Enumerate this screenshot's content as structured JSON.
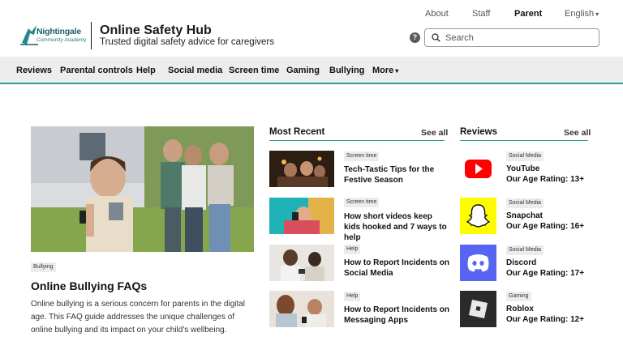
{
  "brand": {
    "logo_name": "Nightingale",
    "logo_sub": "Community Academy",
    "site_title": "Online Safety Hub",
    "site_subtitle": "Trusted digital safety advice for caregivers"
  },
  "top_nav": {
    "about": "About",
    "staff": "Staff",
    "parent": "Parent",
    "language": "English",
    "help_symbol": "?"
  },
  "search": {
    "placeholder": "Search",
    "value": ""
  },
  "main_nav": {
    "items": [
      "Reviews",
      "Parental controls",
      "Help",
      "Social media",
      "Screen time",
      "Gaming",
      "Bullying",
      "More"
    ]
  },
  "featured": {
    "tag": "Bullying",
    "title": "Online Bullying FAQs",
    "description": "Online bullying is a serious concern for parents in the digital age. This FAQ guide addresses the unique challenges of online bullying and its impact on your child's wellbeing."
  },
  "most_recent": {
    "heading": "Most Recent",
    "see_all": "See all",
    "articles": [
      {
        "tag": "Screen time",
        "title": "Tech-Tastic Tips for the Festive Season"
      },
      {
        "tag": "Screen time",
        "title": "How short videos keep kids hooked and 7 ways to help"
      },
      {
        "tag": "Help",
        "title": "How to Report Incidents on Social Media"
      },
      {
        "tag": "Help",
        "title": "How to Report Incidents on Messaging Apps"
      }
    ]
  },
  "reviews": {
    "heading": "Reviews",
    "see_all": "See all",
    "items": [
      {
        "tag": "Social Media",
        "name": "YouTube",
        "rating": "Our Age Rating: 13+",
        "icon": "youtube-icon",
        "color": "#ffffff"
      },
      {
        "tag": "Social Media",
        "name": "Snapchat",
        "rating": "Our Age Rating: 16+",
        "icon": "snapchat-icon",
        "color": "#fffc00"
      },
      {
        "tag": "Social Media",
        "name": "Discord",
        "rating": "Our Age Rating: 17+",
        "icon": "discord-icon",
        "color": "#5865f2"
      },
      {
        "tag": "Gaming",
        "name": "Roblox",
        "rating": "Our Age Rating: 12+",
        "icon": "roblox-icon",
        "color": "#2b2b2b"
      }
    ]
  },
  "colors": {
    "accent": "#2a9d8f",
    "nav_bg": "#ededed",
    "youtube_red": "#ff0000"
  }
}
